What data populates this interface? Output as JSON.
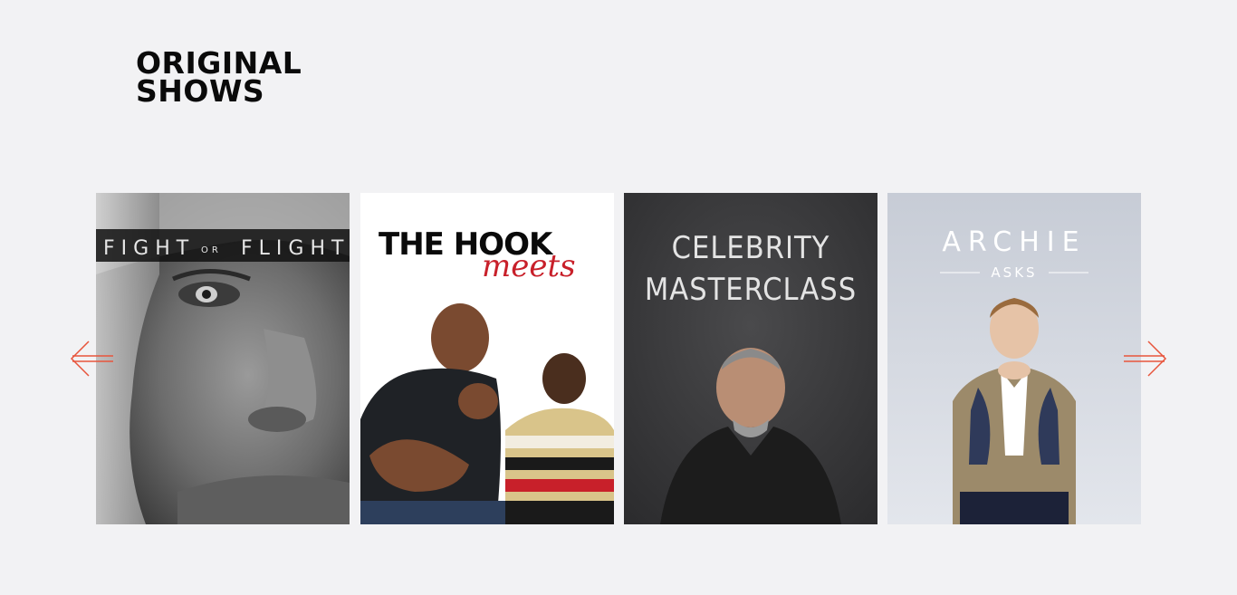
{
  "section": {
    "title_line1": "ORIGINAL",
    "title_line2": "SHOWS"
  },
  "colors": {
    "background": "#f2f2f4",
    "accent_arrow": "#e8553c",
    "hook_red": "#c8202a"
  },
  "carousel": {
    "prev_icon": "arrow-left-icon",
    "next_icon": "arrow-right-icon",
    "shows": [
      {
        "title_part1": "FIGHT",
        "title_part2": "OR",
        "title_part3": "FLIGHT"
      },
      {
        "title_main": "THE HOOK",
        "title_script": "meets"
      },
      {
        "title_line1": "CELEBRITY",
        "title_line2": "MASTERCLASS"
      },
      {
        "title_main": "ARCHIE",
        "title_sub": "ASKS"
      }
    ]
  }
}
